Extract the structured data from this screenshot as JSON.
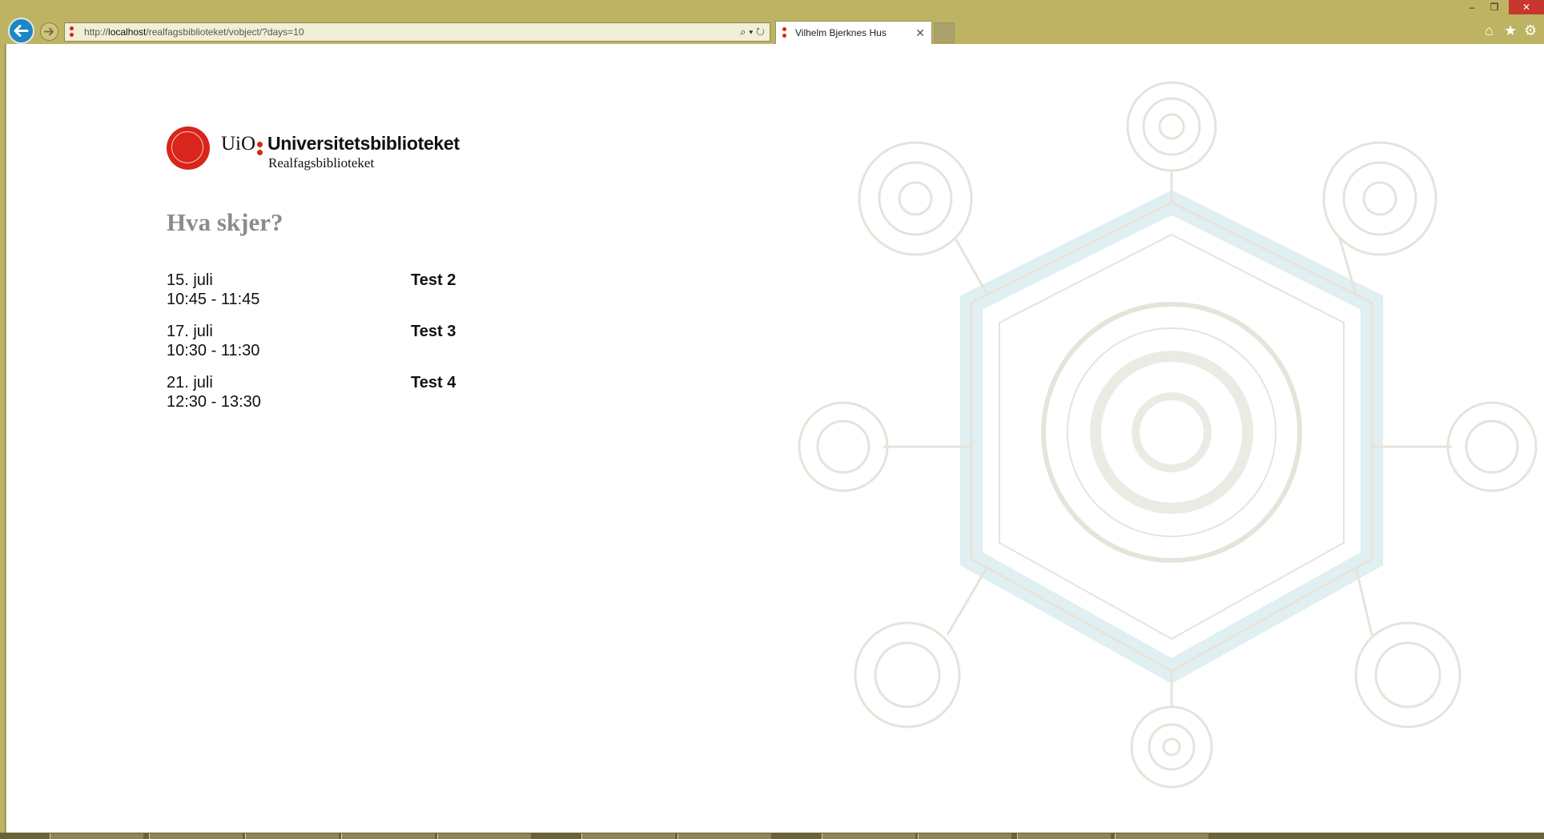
{
  "browser": {
    "address": {
      "prefix": "http://",
      "host": "localhost",
      "path": "/realfagsbiblioteket/vobject/?days=10"
    },
    "address_tools": "⌕ ▾ ↻",
    "tab": {
      "title": "Vilhelm Bjerknes Hus",
      "close": "✕"
    },
    "window_controls": {
      "minimize": "–",
      "restore": "❐",
      "close": "✕"
    },
    "nav_icons": {
      "home": "⌂",
      "favorites": "★",
      "settings": "⚙"
    }
  },
  "logo": {
    "uio": "UiO",
    "institution": "Universitetsbiblioteket",
    "library": "Realfagsbiblioteket"
  },
  "heading": "Hva skjer?",
  "events": [
    {
      "date": "15. juli",
      "time": "10:45 - 11:45",
      "title": "Test 2"
    },
    {
      "date": "17. juli",
      "time": "10:30 - 11:30",
      "title": "Test 3"
    },
    {
      "date": "21. juli",
      "time": "12:30 - 13:30",
      "title": "Test 4"
    }
  ],
  "colors": {
    "chrome": "#bdb363",
    "brand_red": "#d9251c",
    "heading_gray": "#8c8c8c",
    "link_blue": "#1c86c8"
  }
}
